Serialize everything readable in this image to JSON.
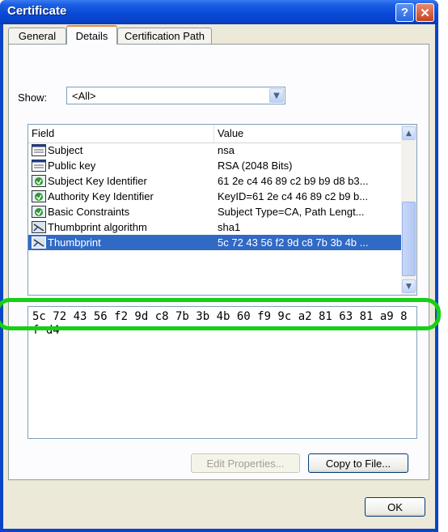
{
  "window": {
    "title": "Certificate"
  },
  "tabs": [
    {
      "label": "General"
    },
    {
      "label": "Details"
    },
    {
      "label": "Certification Path"
    }
  ],
  "show": {
    "label": "Show:",
    "value": "<All>"
  },
  "list": {
    "columns": {
      "field": "Field",
      "value": "Value"
    },
    "rows": [
      {
        "field": "Subject",
        "value": "nsa",
        "icon": "cert-field-icon"
      },
      {
        "field": "Public key",
        "value": "RSA (2048 Bits)",
        "icon": "cert-field-icon"
      },
      {
        "field": "Subject Key Identifier",
        "value": "61 2e c4 46 89 c2 b9 b9 d8 b3...",
        "icon": "cert-extension-icon"
      },
      {
        "field": "Authority Key Identifier",
        "value": "KeyID=61 2e c4 46 89 c2 b9 b...",
        "icon": "cert-extension-icon"
      },
      {
        "field": "Basic Constraints",
        "value": "Subject Type=CA, Path Lengt...",
        "icon": "cert-extension-icon"
      },
      {
        "field": "Thumbprint algorithm",
        "value": "sha1",
        "icon": "cert-property-icon"
      },
      {
        "field": "Thumbprint",
        "value": "5c 72 43 56 f2 9d c8 7b 3b 4b ...",
        "icon": "cert-property-icon",
        "selected": true
      }
    ]
  },
  "detail": {
    "text": "5c 72 43 56 f2 9d c8 7b 3b 4b 60 f9 9c a2 81 63 81 a9 8f d4"
  },
  "buttons": {
    "edit": "Edit Properties...",
    "copy": "Copy to File...",
    "ok": "OK"
  },
  "colors": {
    "highlight": "#16d016",
    "selection": "#316ac5",
    "titlebar": "#0a4ad8"
  }
}
